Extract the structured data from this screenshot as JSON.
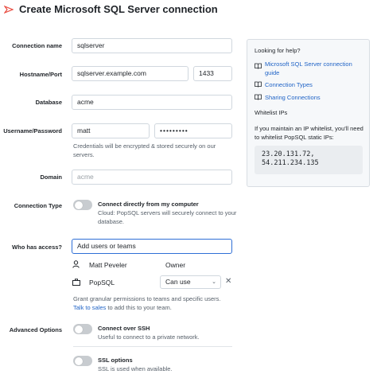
{
  "header": {
    "title": "Create Microsoft SQL Server connection",
    "logo_color": "#e8473b"
  },
  "form": {
    "connection_name": {
      "label": "Connection name",
      "value": "sqlserver"
    },
    "hostname_port": {
      "label": "Hostname/Port",
      "hostname": "sqlserver.example.com",
      "port": "1433"
    },
    "database": {
      "label": "Database",
      "value": "acme"
    },
    "username_password": {
      "label": "Username/Password",
      "username": "matt",
      "password": "•••••••••",
      "help": "Credentials will be encrypted & stored securely on our servers."
    },
    "domain": {
      "label": "Domain",
      "placeholder": "acme"
    },
    "connection_type": {
      "label": "Connection Type",
      "toggle_title": "Connect directly from my computer",
      "toggle_desc": "Cloud: PopSQL servers will securely connect to your database.",
      "enabled": false
    },
    "access": {
      "label": "Who has access?",
      "input_value": "Add users or teams",
      "user": {
        "name": "Matt Peveler",
        "role": "Owner"
      },
      "team": {
        "name": "PopSQL",
        "permission": "Can use",
        "remove": "✕"
      },
      "help_line1": "Grant granular permissions to teams and specific users.",
      "help_link": "Talk to sales",
      "help_suffix": "to add this to your team."
    },
    "advanced": {
      "label": "Advanced Options",
      "ssh": {
        "title": "Connect over SSH",
        "desc": "Useful to connect to a private network.",
        "enabled": false
      },
      "ssl": {
        "title": "SSL options",
        "desc": "SSL is used when available.",
        "enabled": false
      }
    }
  },
  "help_panel": {
    "title": "Looking for help?",
    "links": [
      "Microsoft SQL Server connection guide",
      "Connection Types",
      "Sharing Connections"
    ],
    "link_icon": "book-icon",
    "whitelist_title": "Whitelist IPs",
    "whitelist_text": "If you maintain an IP whitelist, you'll need to whitelist PopSQL static IPs:",
    "ips": "23.20.131.72,\n54.211.234.135"
  },
  "colors": {
    "link": "#1f63c6",
    "focus": "#2f6fd6",
    "toggle_off": "#c8ccd0"
  }
}
